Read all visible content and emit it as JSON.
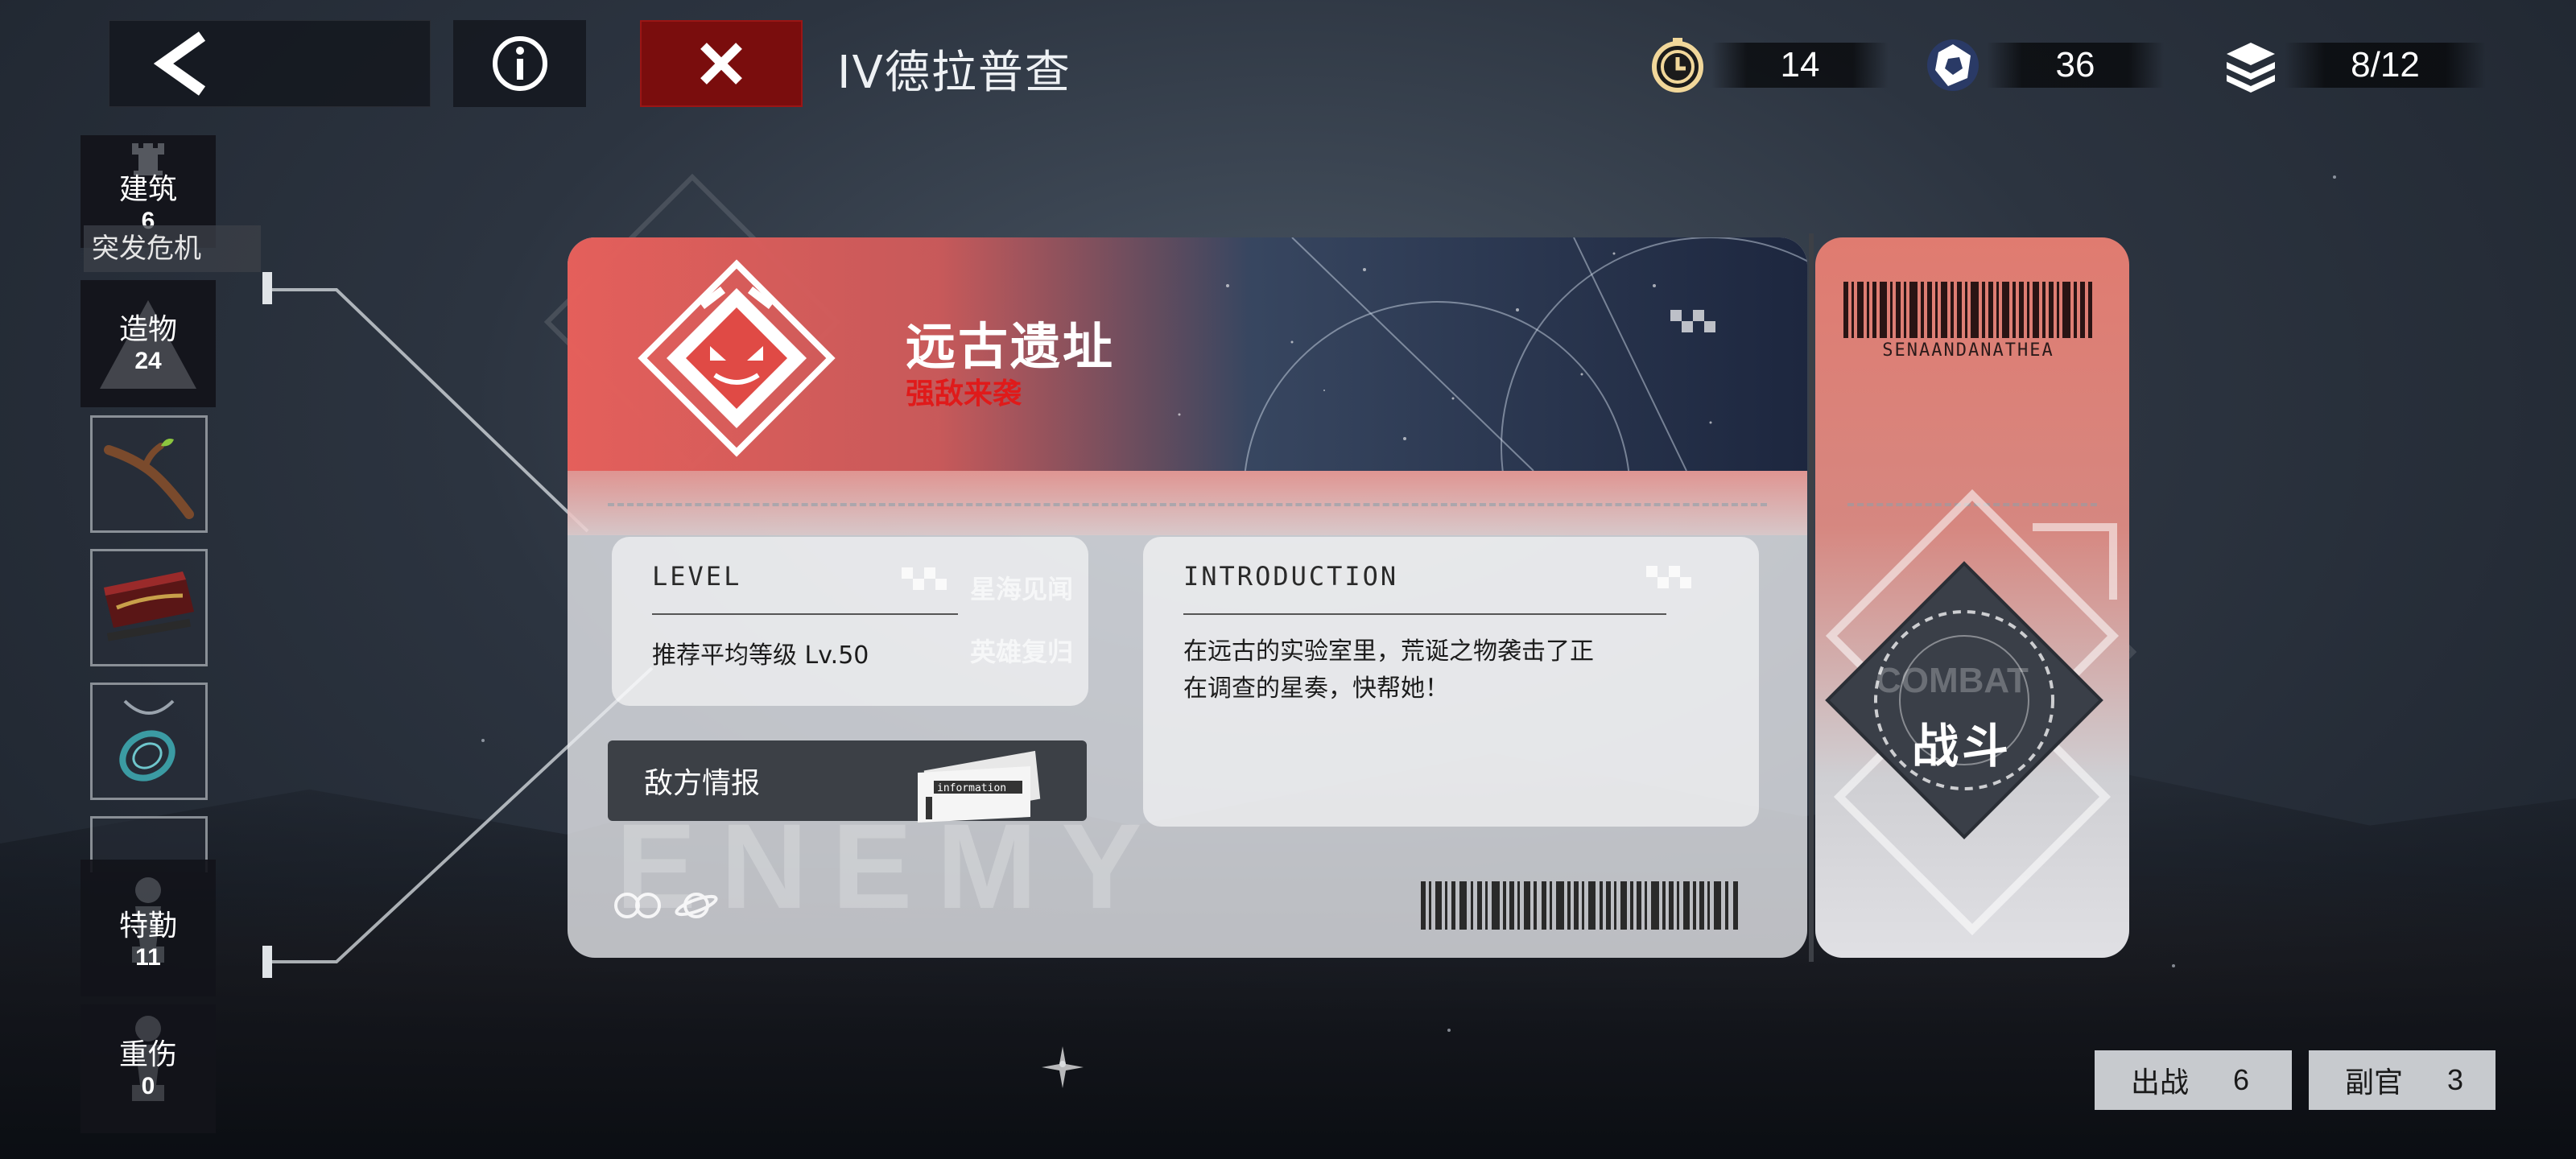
{
  "header": {
    "stage_title": "IV德拉普查",
    "resources": [
      {
        "icon": "stopwatch-icon",
        "value": "14"
      },
      {
        "icon": "crystal-icon",
        "value": "36"
      },
      {
        "icon": "stack-icon",
        "value": "8/12"
      }
    ]
  },
  "sidebar": {
    "building": {
      "label": "建筑",
      "count": "6"
    },
    "crisis_tag": "突发危机",
    "artifact": {
      "label": "造物",
      "count": "24"
    },
    "special": {
      "label": "特勤",
      "count": "11"
    },
    "injured": {
      "label": "重伤",
      "count": "0"
    }
  },
  "card": {
    "location": "远古遗址",
    "subtitle": "强敌来袭",
    "level_heading": "LEVEL",
    "level_text": "推荐平均等级 Lv.50",
    "intro_heading": "INTRODUCTION",
    "intro_text_line1": "在远古的实验室里，荒诞之物袭击了正",
    "intro_text_line2": "在调查的星奏，快帮她！",
    "enemy_info_label": "敌方情报",
    "info_icon_text": "information",
    "ghost_text_1": "星海见闻",
    "ghost_text_2": "英雄复归",
    "bg_word": "ENEMY"
  },
  "stub": {
    "code_text": "SENAANDANATHEA",
    "fight_label": "战斗",
    "combat_watermark": "COMBAT"
  },
  "bottom": {
    "deploy_label": "出战",
    "deploy_count": "6",
    "adjutant_label": "副官",
    "adjutant_count": "3"
  },
  "colors": {
    "accent_red": "#e01a1a",
    "close_bg": "#7a0d0d",
    "card_top_red": "#e65a55",
    "panel_dark": "#3c4046"
  }
}
